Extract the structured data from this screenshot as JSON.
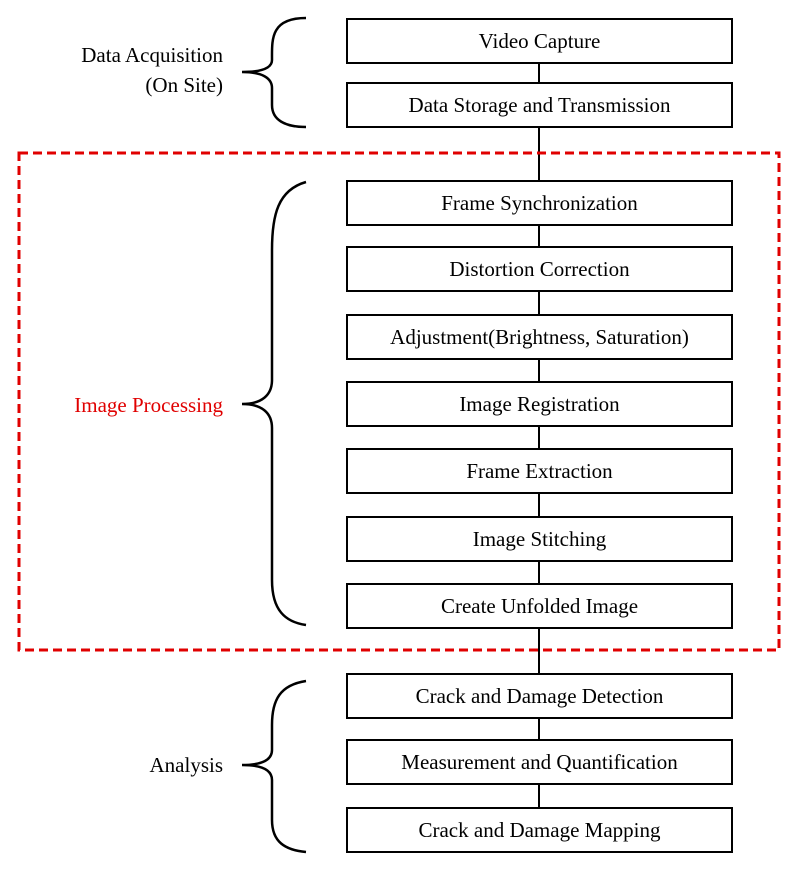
{
  "groups": [
    {
      "label_lines": [
        "Data Acquisition",
        "(On Site)"
      ],
      "color": "#000000",
      "steps": [
        "Video Capture",
        "Data Storage and Transmission"
      ]
    },
    {
      "label_lines": [
        "Image Processing"
      ],
      "color": "#e00000",
      "highlighted": true,
      "steps": [
        "Frame Synchronization",
        "Distortion Correction",
        "Adjustment(Brightness, Saturation)",
        "Image Registration",
        "Frame Extraction",
        "Image Stitching",
        "Create Unfolded Image"
      ]
    },
    {
      "label_lines": [
        "Analysis"
      ],
      "color": "#000000",
      "steps": [
        "Crack and Damage Detection",
        "Measurement and Quantification",
        "Crack and Damage Mapping"
      ]
    }
  ]
}
